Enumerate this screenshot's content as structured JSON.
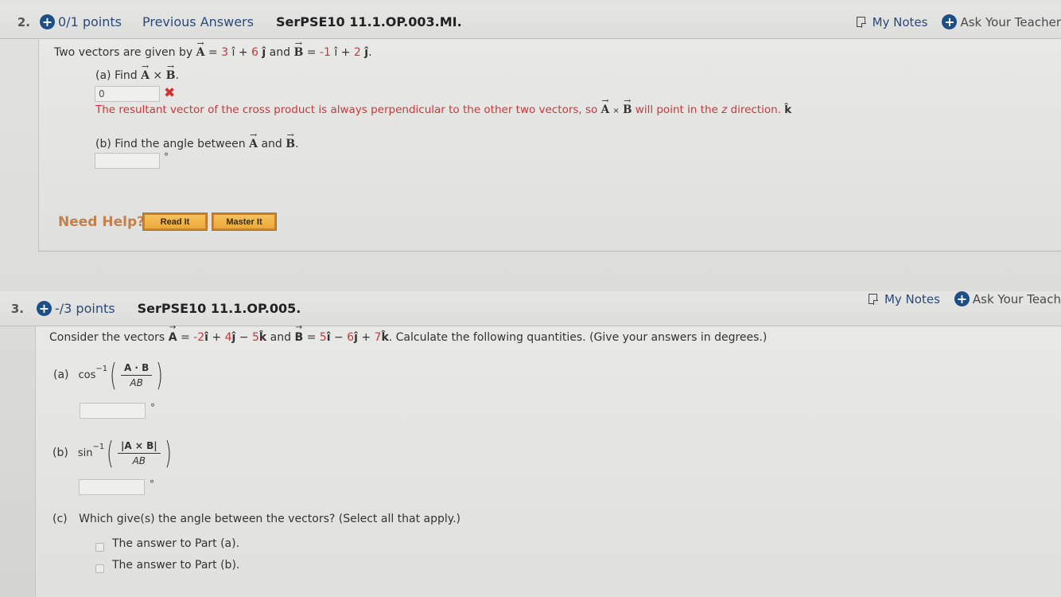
{
  "question2": {
    "number": "2.",
    "points": "0/1 points",
    "previous_answers": "Previous Answers",
    "code": "SerPSE10 11.1.OP.003.MI.",
    "my_notes": "My Notes",
    "ask_teacher": "Ask Your Teacher",
    "prompt_pre": "Two vectors are given by",
    "vecA": "A",
    "vecB": "B",
    "A_eq": " = ",
    "A_i": "3",
    "A_j": "6",
    "B_i": "-1",
    "B_j": "2",
    "i_hat": "î",
    "j_hat": "ĵ",
    "and": "and",
    "plus": "+",
    "part_a": {
      "label": "(a) Find",
      "times": "×",
      "answer_value": "0",
      "status": "incorrect",
      "feedback_pre": "The resultant vector of the cross product is always perpendicular to the other two vectors, so",
      "feedback_post": "will point in the",
      "feedback_z": "z",
      "feedback_end": "direction.",
      "k_hat": "k̂"
    },
    "part_b": {
      "label": "(b) Find the angle between",
      "and": "and",
      "answer_value": "",
      "unit": "°"
    },
    "need_help": "Need Help?",
    "read_it": "Read It",
    "master_it": "Master It"
  },
  "question3": {
    "number": "3.",
    "points": "-/3 points",
    "code": "SerPSE10 11.1.OP.005.",
    "my_notes": "My Notes",
    "ask_teacher": "Ask Your Teach",
    "prompt_pre": "Consider the vectors",
    "A_i": "-2",
    "A_j": "4",
    "A_k": "5",
    "B_i": "5",
    "B_j": "6",
    "B_k": "7",
    "prompt_post": ". Calculate the following quantities. (Give your answers in degrees.)",
    "part_a": {
      "label": "(a)",
      "func": "cos",
      "exp": "−1",
      "num": "A · B",
      "den": "AB",
      "answer_value": "",
      "unit": "°"
    },
    "part_b": {
      "label": "(b)",
      "func": "sin",
      "exp": "−1",
      "num": "|A × B|",
      "den": "AB",
      "answer_value": "",
      "unit": "°"
    },
    "part_c": {
      "label": "(c)",
      "question": "Which give(s) the angle between the vectors? (Select all that apply.)",
      "options": [
        {
          "label": "The answer to Part (a).",
          "checked": false
        },
        {
          "label": "The answer to Part (b).",
          "checked": false
        }
      ]
    }
  }
}
